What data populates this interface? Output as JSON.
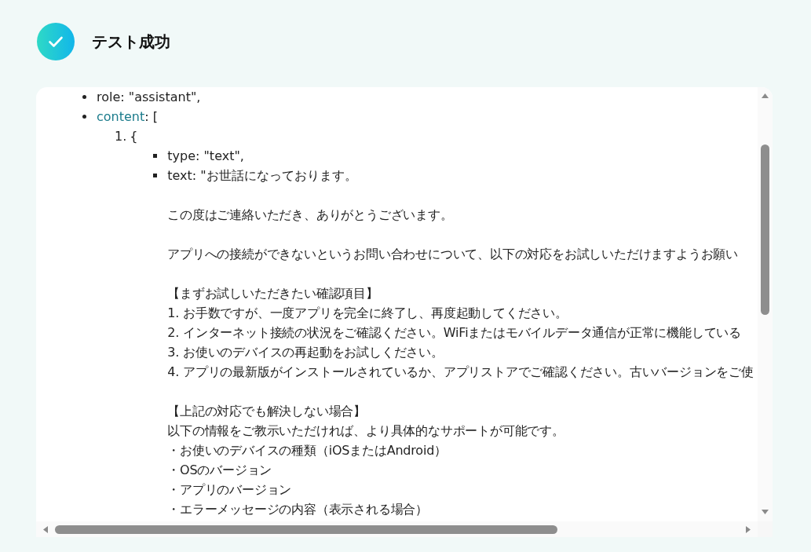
{
  "result": {
    "success": true,
    "title": "テスト成功"
  },
  "output": {
    "tree": [
      {
        "kind": "bullet",
        "key": "role",
        "expandable": false,
        "rest": ": \"assistant\","
      },
      {
        "kind": "bullet",
        "key": "content",
        "expandable": true,
        "rest": ": [",
        "children": [
          {
            "kind": "numbered",
            "number": "1.",
            "rest": "{",
            "children": [
              {
                "kind": "square",
                "key": "type",
                "expandable": false,
                "rest": ": \"text\","
              },
              {
                "kind": "square",
                "key": "text",
                "expandable": false,
                "rest": ": \"お世話になっております。",
                "paragraphs": [
                  [
                    "この度はご連絡いただき、ありがとうございます。"
                  ],
                  [
                    "アプリへの接続ができないというお問い合わせについて、以下の対応をお試しいただけますようお願い"
                  ],
                  [
                    "【まずお試しいただきたい確認項目】",
                    "1. お手数ですが、一度アプリを完全に終了し、再度起動してください。",
                    "2. インターネット接続の状況をご確認ください。WiFiまたはモバイルデータ通信が正常に機能している",
                    "3. お使いのデバイスの再起動をお試しください。",
                    "4. アプリの最新版がインストールされているか、アプリストアでご確認ください。古いバージョンをご使"
                  ],
                  [
                    "【上記の対応でも解決しない場合】",
                    "以下の情報をご教示いただければ、より具体的なサポートが可能です。",
                    "・お使いのデバイスの種類（iOSまたはAndroid）",
                    "・OSのバージョン",
                    "・アプリのバージョン",
                    "・エラーメッセージの内容（表示される場合）"
                  ]
                ]
              }
            ]
          }
        ]
      }
    ]
  }
}
